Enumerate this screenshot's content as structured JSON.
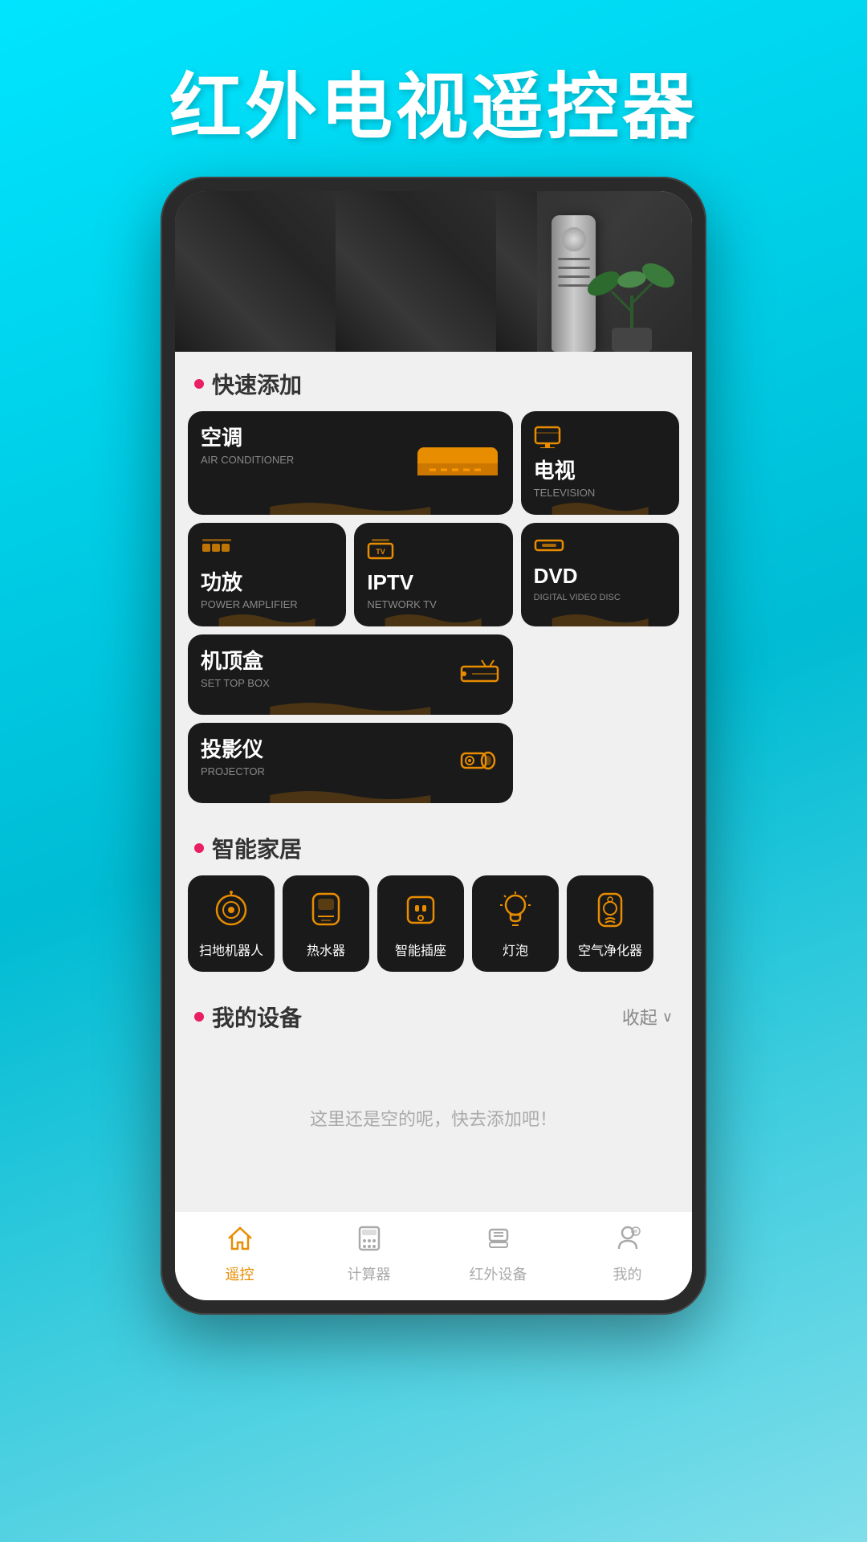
{
  "app_title": "红外电视遥控器",
  "sections": {
    "quick_add": "快速添加",
    "smart_home": "智能家居",
    "my_devices": "我的设备",
    "collapse": "收起"
  },
  "quick_add_devices": [
    {
      "id": "ac",
      "name_zh": "空调",
      "name_en": "AIR CONDITIONER",
      "size": "large",
      "icon": "ac"
    },
    {
      "id": "tv",
      "name_zh": "电视",
      "name_en": "TELEVISION",
      "size": "normal",
      "icon": "tv"
    },
    {
      "id": "dvd",
      "name_zh": "DVD",
      "name_en": "DIGITAL VIDEO DISC",
      "size": "normal",
      "icon": "dvd"
    },
    {
      "id": "amplifier",
      "name_zh": "功放",
      "name_en": "POWER AMPLIFIER",
      "size": "normal",
      "icon": "amplifier"
    },
    {
      "id": "iptv",
      "name_zh": "IPTV",
      "name_en": "NETWORK TV",
      "size": "normal",
      "icon": "iptv"
    },
    {
      "id": "settopbox",
      "name_zh": "机顶盒",
      "name_en": "SET TOP BOX",
      "size": "wide",
      "icon": "settopbox"
    },
    {
      "id": "projector",
      "name_zh": "投影仪",
      "name_en": "PROJECTOR",
      "size": "wide",
      "icon": "projector"
    }
  ],
  "smart_devices": [
    {
      "id": "robot",
      "name": "扫地机器人",
      "icon": "robot"
    },
    {
      "id": "heater",
      "name": "热水器",
      "icon": "heater"
    },
    {
      "id": "socket",
      "name": "智能插座",
      "icon": "socket"
    },
    {
      "id": "bulb",
      "name": "灯泡",
      "icon": "bulb"
    },
    {
      "id": "purifier",
      "name": "空气净化器",
      "icon": "purifier"
    }
  ],
  "empty_devices_tip": "这里还是空的呢，快去添加吧！",
  "bottom_nav": [
    {
      "id": "remote",
      "label": "遥控",
      "active": true
    },
    {
      "id": "calculator",
      "label": "计算器",
      "active": false
    },
    {
      "id": "ir_devices",
      "label": "红外设备",
      "active": false
    },
    {
      "id": "mine",
      "label": "我的",
      "active": false
    }
  ],
  "colors": {
    "accent": "#e88c00",
    "background": "#00e5ff",
    "card_bg": "#1a1a1a",
    "active_nav": "#e88c00",
    "section_dot": "#e91e63"
  }
}
